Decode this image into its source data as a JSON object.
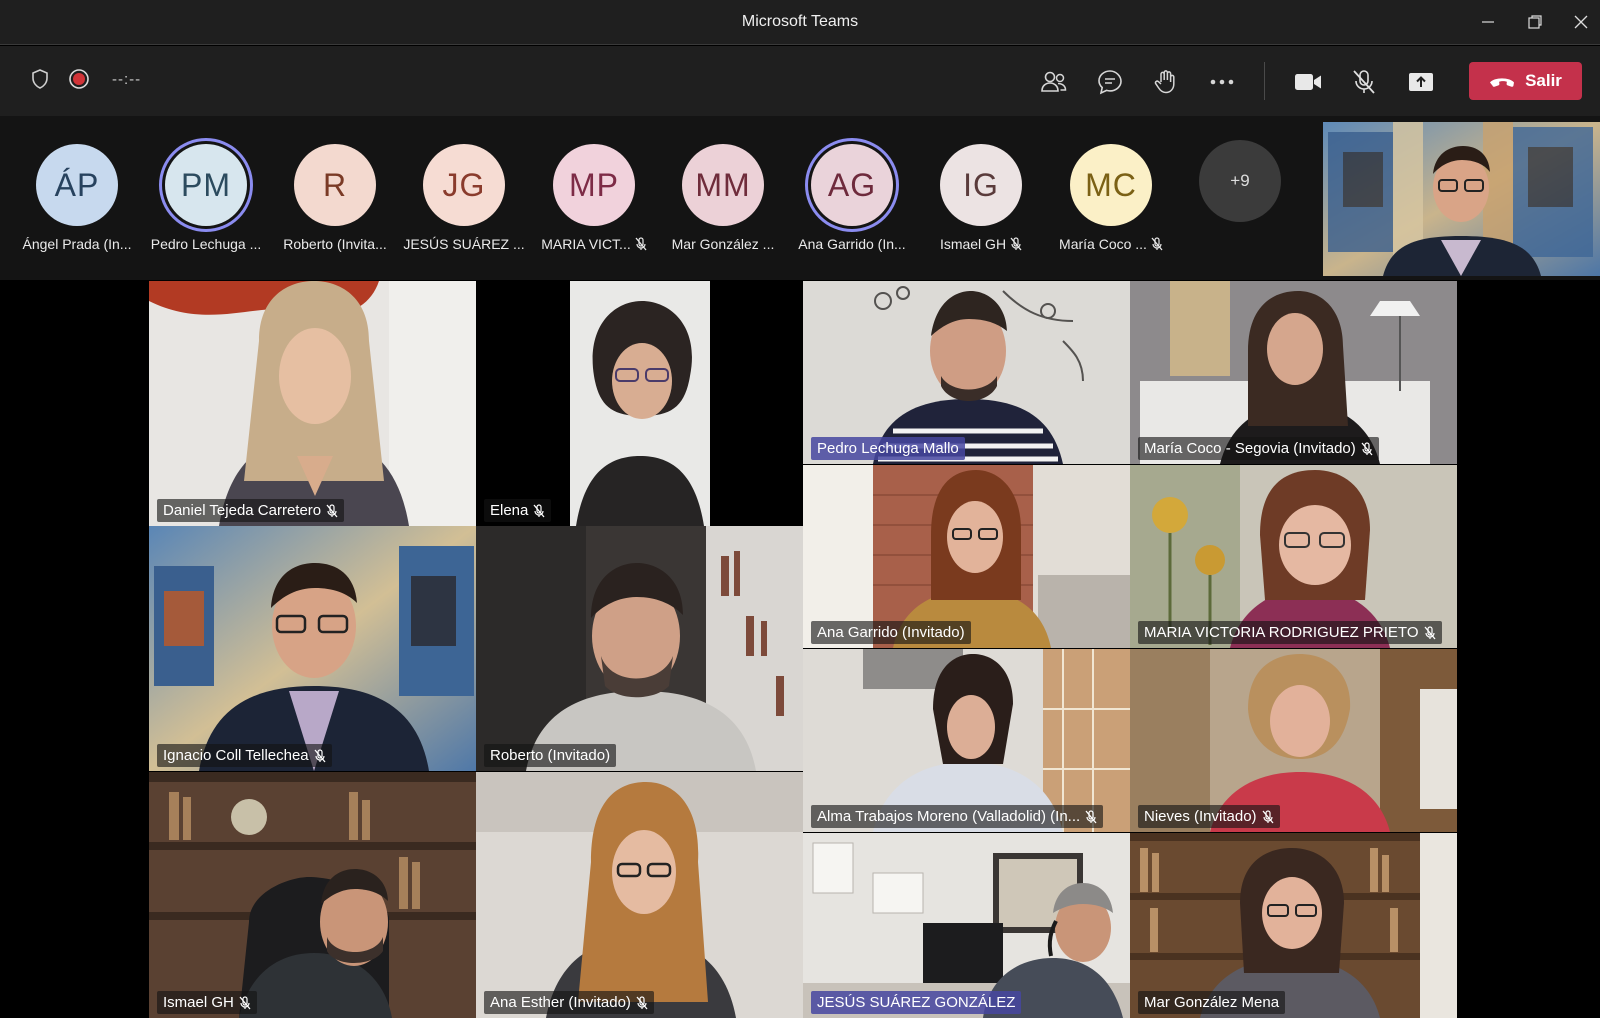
{
  "window": {
    "title": "Microsoft Teams"
  },
  "toolbar": {
    "timer": "--:--",
    "leave_label": "Salir"
  },
  "roster": [
    {
      "initials": "ÁP",
      "name": "Ángel Prada (In...",
      "color": "#c7d9ee",
      "text": "#27425e",
      "muted": false,
      "speaking": false
    },
    {
      "initials": "PM",
      "name": "Pedro Lechuga ...",
      "color": "#d7e6ee",
      "text": "#2c4b5e",
      "muted": false,
      "speaking": true
    },
    {
      "initials": "R",
      "name": "Roberto (Invita...",
      "color": "#f3d9cf",
      "text": "#7a3a26",
      "muted": false,
      "speaking": false
    },
    {
      "initials": "JG",
      "name": "JESÚS SUÁREZ ...",
      "color": "#f6dcd3",
      "text": "#8a3b2c",
      "muted": false,
      "speaking": false
    },
    {
      "initials": "MP",
      "name": "MARIA VICT...",
      "color": "#f1d2dc",
      "text": "#7d2b46",
      "muted": true,
      "speaking": false
    },
    {
      "initials": "MM",
      "name": "Mar González ...",
      "color": "#ecd1d7",
      "text": "#6f2c3b",
      "muted": false,
      "speaking": false
    },
    {
      "initials": "AG",
      "name": "Ana Garrido (In...",
      "color": "#ead3da",
      "text": "#6e2a3c",
      "muted": false,
      "speaking": true
    },
    {
      "initials": "IG",
      "name": "Ismael GH",
      "color": "#ece3e3",
      "text": "#5a3b3b",
      "muted": true,
      "speaking": false
    },
    {
      "initials": "MC",
      "name": "María Coco ...",
      "color": "#fbf0c7",
      "text": "#7b6115",
      "muted": true,
      "speaking": false
    }
  ],
  "overflow_count": "+9",
  "tiles": [
    {
      "name": "Daniel Tejeda Carretero",
      "muted": true,
      "active": false
    },
    {
      "name": "Elena",
      "muted": true,
      "active": false
    },
    {
      "name": "Pedro Lechuga Mallo",
      "muted": false,
      "active": true
    },
    {
      "name": "María Coco - Segovia (Invitado)",
      "muted": true,
      "active": false
    },
    {
      "name": "Ana Garrido (Invitado)",
      "muted": false,
      "active": false
    },
    {
      "name": "MARIA VICTORIA RODRIGUEZ PRIETO",
      "muted": true,
      "active": false
    },
    {
      "name": "Ignacio Coll Tellechea",
      "muted": true,
      "active": false
    },
    {
      "name": "Roberto (Invitado)",
      "muted": false,
      "active": false
    },
    {
      "name": "Alma Trabajos Moreno (Valladolid) (In...",
      "muted": true,
      "active": false
    },
    {
      "name": "Nieves (Invitado)",
      "muted": true,
      "active": false
    },
    {
      "name": "Ismael GH",
      "muted": true,
      "active": false
    },
    {
      "name": "Ana Esther (Invitado)",
      "muted": true,
      "active": false
    },
    {
      "name": "JESÚS SUÁREZ GONZÁLEZ",
      "muted": false,
      "active": true
    },
    {
      "name": "Mar González Mena",
      "muted": false,
      "active": false
    }
  ],
  "icons": {
    "shield": "shield-icon",
    "record": "record-icon",
    "participants": "participants-icon",
    "chat": "chat-icon",
    "raise_hand": "raise-hand-icon",
    "more": "more-options-icon",
    "camera": "camera-icon",
    "mic_off": "mic-off-icon",
    "share": "share-screen-icon",
    "hangup": "hangup-icon"
  },
  "colors": {
    "leave": "#c4314b",
    "speaking_ring": "#8b8cf0",
    "active_label": "#4647a0"
  }
}
